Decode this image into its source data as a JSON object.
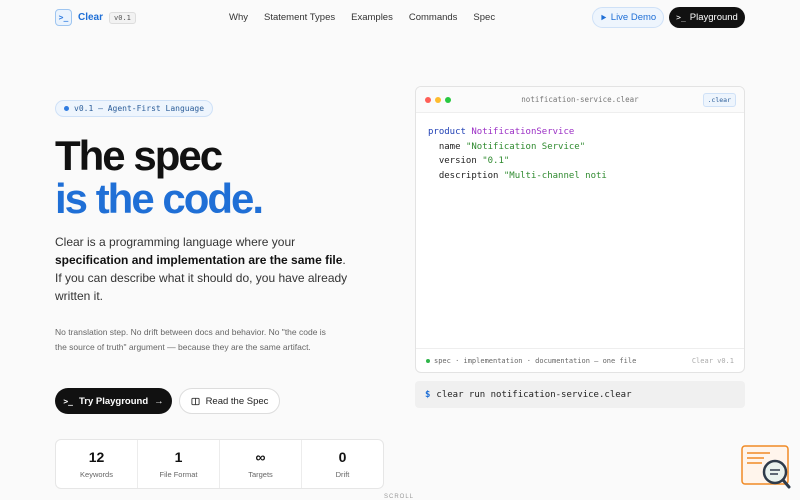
{
  "nav": {
    "logo_mark": ">_",
    "logo_text": "Clear",
    "version": "v0.1",
    "links": [
      "Why",
      "Statement Types",
      "Examples",
      "Commands",
      "Spec"
    ],
    "live_demo": "Live Demo",
    "playground": "Playground",
    "live_icon": "play-icon",
    "playground_icon": "terminal-icon"
  },
  "hero": {
    "badge": "v0.1 — Agent-First Language",
    "title_line1": "The spec",
    "title_line2": "is the code.",
    "lead_1": "Clear is a programming language where your ",
    "lead_bold": "specification and implementation are the same file",
    "lead_2": ". If you can describe what it should do, you have already written it.",
    "sub": "No translation step. No drift between docs and behavior. No \"the code is the source of truth\" argument — because they are the same artifact.",
    "try_button": "Try Playground",
    "read_button": "Read the Spec"
  },
  "stats": [
    {
      "value": "12",
      "label": "Keywords"
    },
    {
      "value": "1",
      "label": "File Format"
    },
    {
      "value": "∞",
      "label": "Targets"
    },
    {
      "value": "0",
      "label": "Drift"
    }
  ],
  "scroll_hint": "SCROLL",
  "editor": {
    "filename": "notification-service.clear",
    "extension": ".clear",
    "line1_kw": "product",
    "line1_name": "NotificationService",
    "line2_key": "  name",
    "line2_val": "\"Notification Service\"",
    "line3_key": "  version",
    "line3_val": "\"0.1\"",
    "line4_key": "  description",
    "line4_val": "\"Multi-channel noti",
    "footer_left": "spec · implementation · documentation — one file",
    "footer_right": "Clear v0.1"
  },
  "terminal": {
    "prompt": "$",
    "command": "clear run notification-service.clear"
  },
  "colors": {
    "accent": "#1f6fd6",
    "dark": "#111111",
    "traffic_red": "#ff5f57",
    "traffic_yellow": "#febc2e",
    "traffic_green": "#28c840",
    "widget_orange": "#f08a24"
  }
}
